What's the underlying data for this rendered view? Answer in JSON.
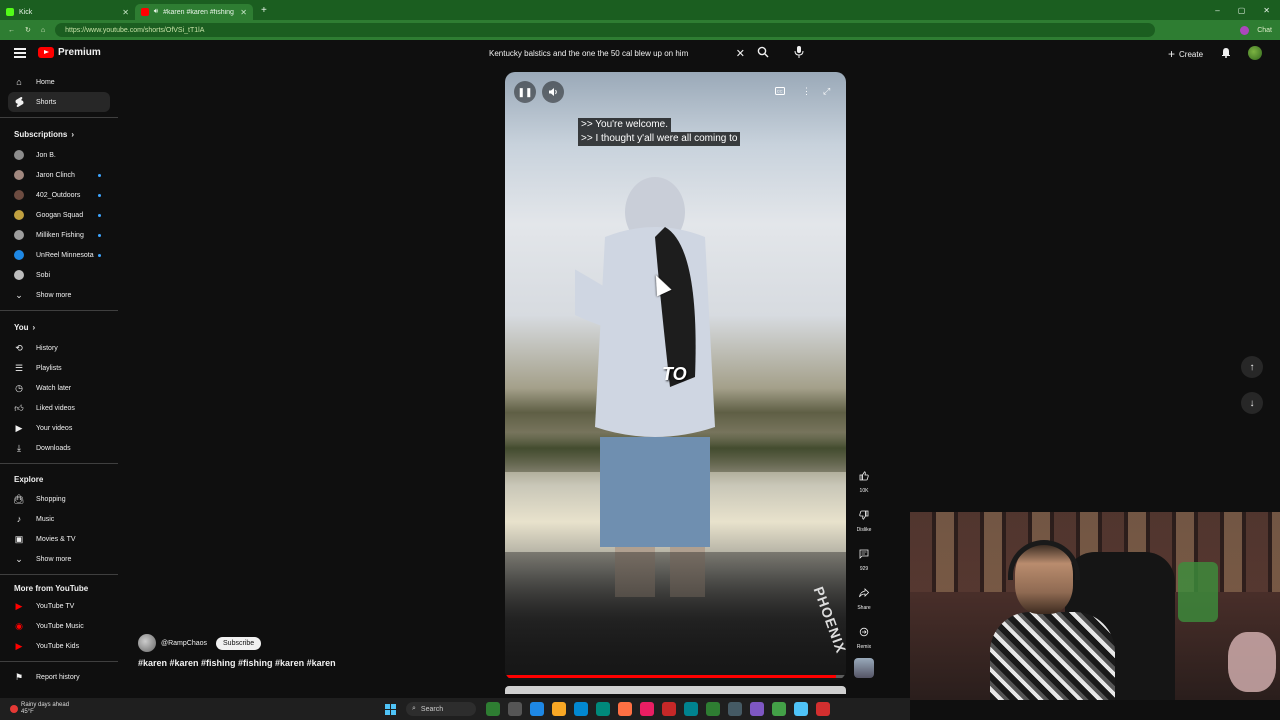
{
  "browser": {
    "tabs": [
      {
        "label": "Kick",
        "color": "#53fc18"
      },
      {
        "label": "#karen #karen #fishing #fishi",
        "color": "#ff0000"
      }
    ],
    "url": "https://www.youtube.com/shorts/OfVSi_tT1lA",
    "chat_label": "Chat"
  },
  "header": {
    "logo_text": "Premium",
    "search_value": "Kentucky balstics and the one the 50 cal blew up on him",
    "create_label": "Create"
  },
  "sidebar": {
    "main": [
      {
        "label": "Home",
        "icon": "home-icon"
      },
      {
        "label": "Shorts",
        "icon": "shorts-icon",
        "active": true
      }
    ],
    "subscriptions_title": "Subscriptions",
    "subscriptions": [
      {
        "label": "Jon B.",
        "dot": false,
        "color": "#8d8d8d"
      },
      {
        "label": "Jaron Clinch",
        "dot": true,
        "color": "#a1887f"
      },
      {
        "label": "402_Outdoors",
        "dot": true,
        "color": "#6d4c41"
      },
      {
        "label": "Googan Squad",
        "dot": true,
        "color": "#c0a040"
      },
      {
        "label": "Milliken Fishing",
        "dot": true,
        "color": "#9e9e9e"
      },
      {
        "label": "UnReel Minnesota",
        "dot": true,
        "color": "#1e88e5"
      },
      {
        "label": "Sobi",
        "dot": false,
        "color": "#bdbdbd"
      }
    ],
    "show_more_1": "Show more",
    "you_title": "You",
    "you_items": [
      {
        "label": "History",
        "icon": "history-icon"
      },
      {
        "label": "Playlists",
        "icon": "playlists-icon"
      },
      {
        "label": "Watch later",
        "icon": "clock-icon"
      },
      {
        "label": "Liked videos",
        "icon": "thumbs-up-icon"
      },
      {
        "label": "Your videos",
        "icon": "video-icon"
      },
      {
        "label": "Downloads",
        "icon": "download-icon"
      }
    ],
    "explore_title": "Explore",
    "explore_items": [
      {
        "label": "Shopping",
        "icon": "shopping-bag-icon"
      },
      {
        "label": "Music",
        "icon": "music-note-icon"
      },
      {
        "label": "Movies & TV",
        "icon": "clapper-icon"
      }
    ],
    "show_more_2": "Show more",
    "more_title": "More from YouTube",
    "more_items": [
      {
        "label": "YouTube TV",
        "icon": "youtube-tv-icon"
      },
      {
        "label": "YouTube Music",
        "icon": "youtube-music-icon"
      },
      {
        "label": "YouTube Kids",
        "icon": "youtube-kids-icon"
      }
    ],
    "report_history": "Report history"
  },
  "player": {
    "caption_lines": [
      ">> You're welcome.",
      ">> I thought y'all were all coming to"
    ],
    "overlay_text": "TO",
    "boat_text": "PHOENIX",
    "progress": 0.97
  },
  "actions": {
    "likes": "10K",
    "dislike": "Dislike",
    "comments": "929",
    "share": "Share",
    "remix": "Remix"
  },
  "channel": {
    "handle": "@RampChaos",
    "subscribe": "Subscribe",
    "hashtags": "#karen #karen #fishing #fishing #karen #karen"
  },
  "taskbar": {
    "weather_line1": "Rainy days ahead",
    "weather_line2": "45°F",
    "search_label": "Search",
    "icon_colors": [
      "#2e7d32",
      "#555",
      "#1e88e5",
      "#f9a825",
      "#0288d1",
      "#00897b",
      "#ff7043",
      "#e91e63",
      "#c62828",
      "#00838f",
      "#2e7d32",
      "#455a64",
      "#7e57c2",
      "#43a047",
      "#4fc3f7",
      "#d32f2f"
    ]
  }
}
